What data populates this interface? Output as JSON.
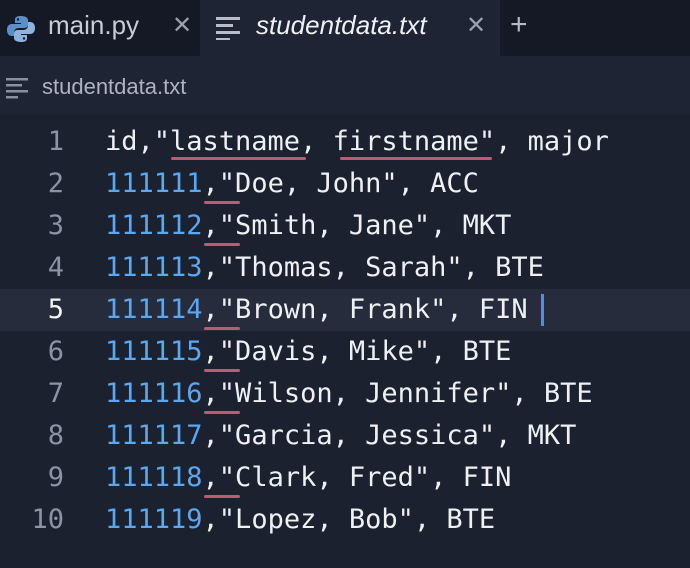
{
  "tabs": [
    {
      "label": "main.py",
      "icon": "python-icon",
      "active": false
    },
    {
      "label": "studentdata.txt",
      "icon": "text-file-icon",
      "active": true
    }
  ],
  "tab_close_glyph": "✕",
  "new_tab_glyph": "+",
  "breadcrumb": {
    "label": "studentdata.txt",
    "icon": "text-file-icon"
  },
  "editor": {
    "current_line": 5,
    "lines": [
      {
        "n": "1",
        "id": "",
        "rest": "id,\"lastname, firstname\", major"
      },
      {
        "n": "2",
        "id": "111111",
        "rest": ",\"Doe, John\", ACC"
      },
      {
        "n": "3",
        "id": "111112",
        "rest": ",\"Smith, Jane\", MKT"
      },
      {
        "n": "4",
        "id": "111113",
        "rest": ",\"Thomas, Sarah\", BTE"
      },
      {
        "n": "5",
        "id": "111114",
        "rest": ",\"Brown, Frank\", FIN"
      },
      {
        "n": "6",
        "id": "111115",
        "rest": ",\"Davis, Mike\", BTE"
      },
      {
        "n": "7",
        "id": "111116",
        "rest": ",\"Wilson, Jennifer\", BTE"
      },
      {
        "n": "8",
        "id": "111117",
        "rest": ",\"Garcia, Jessica\", MKT"
      },
      {
        "n": "9",
        "id": "111118",
        "rest": ",\"Clark, Fred\", FIN"
      },
      {
        "n": "10",
        "id": "111119",
        "rest": ",\"Lopez, Bob\", BTE"
      }
    ]
  },
  "colors": {
    "background": "#1c2130",
    "number": "#5aa7f2",
    "squiggle": "#c05a72",
    "cursor": "#4d8cff"
  }
}
